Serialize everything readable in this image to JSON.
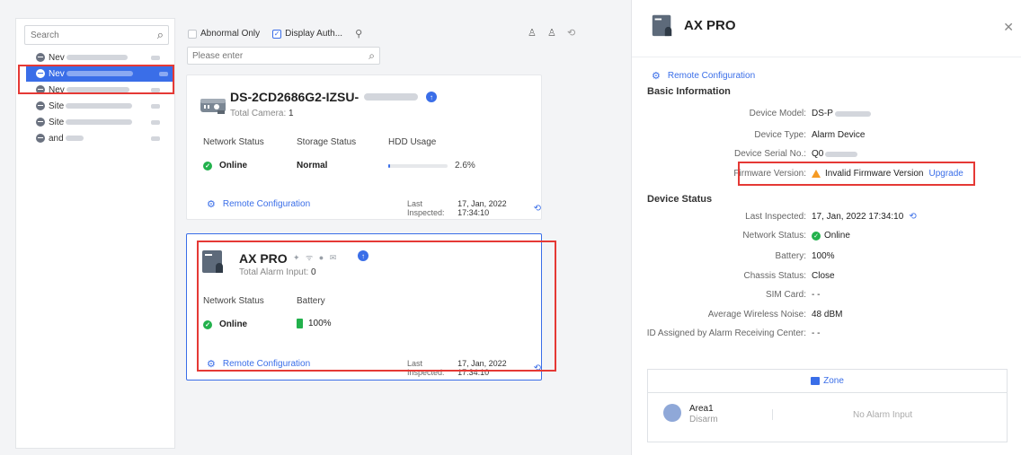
{
  "sidebar": {
    "search_placeholder": "Search",
    "sites": [
      {
        "label": "Nev"
      },
      {
        "label": "Nev"
      },
      {
        "label": "Nev"
      },
      {
        "label": "Site"
      },
      {
        "label": "Site"
      },
      {
        "label": "and"
      }
    ]
  },
  "filters": {
    "abnormal_only": "Abnormal Only",
    "display_auth": "Display Auth...",
    "search_placeholder": "Please enter"
  },
  "camera_card": {
    "title": "DS-2CD2686G2-IZSU-",
    "total_label": "Total Camera:",
    "total_value": "1",
    "network_status_label": "Network Status",
    "storage_status_label": "Storage Status",
    "hdd_usage_label": "HDD Usage",
    "network_status": "Online",
    "storage_status": "Normal",
    "hdd_usage": "2.6%",
    "hdd_fraction": 0.026,
    "remote_config": "Remote Configuration",
    "last_inspected_label": "Last Inspected:",
    "last_inspected": "17, Jan, 2022 17:34:10"
  },
  "alarm_card": {
    "title": "AX PRO",
    "total_label": "Total Alarm Input:",
    "total_value": "0",
    "network_status_label": "Network Status",
    "battery_label": "Battery",
    "network_status": "Online",
    "battery": "100%",
    "remote_config": "Remote Configuration",
    "last_inspected_label": "Last Inspected:",
    "last_inspected": "17, Jan, 2022 17:34:10"
  },
  "detail": {
    "title": "AX PRO",
    "remote_config": "Remote Configuration",
    "basic_info_title": "Basic Information",
    "device_model_label": "Device Model:",
    "device_model": "DS-P",
    "device_type_label": "Device Type:",
    "device_type": "Alarm Device",
    "serial_label": "Device Serial No.:",
    "serial": "Q0",
    "firmware_label": "Firmware Version:",
    "firmware_value": "Invalid Firmware Version",
    "upgrade": "Upgrade",
    "device_status_title": "Device Status",
    "last_inspected_label": "Last Inspected:",
    "last_inspected": "17, Jan, 2022 17:34:10",
    "network_status_label": "Network Status:",
    "network_status": "Online",
    "battery_label": "Battery:",
    "battery": "100%",
    "chassis_label": "Chassis Status:",
    "chassis": "Close",
    "sim_label": "SIM Card:",
    "sim": "- -",
    "noise_label": "Average Wireless Noise:",
    "noise": "48 dBM",
    "arc_id_label": "ID Assigned by Alarm Receiving Center:",
    "arc_id": "- -",
    "zone_tab": "Zone",
    "area_name": "Area1",
    "area_state": "Disarm",
    "no_alarm_input": "No Alarm Input"
  },
  "colors": {
    "accent": "#3a6ee8",
    "online": "#22b14c",
    "highlight": "#e53935",
    "warning": "#f59a23"
  }
}
